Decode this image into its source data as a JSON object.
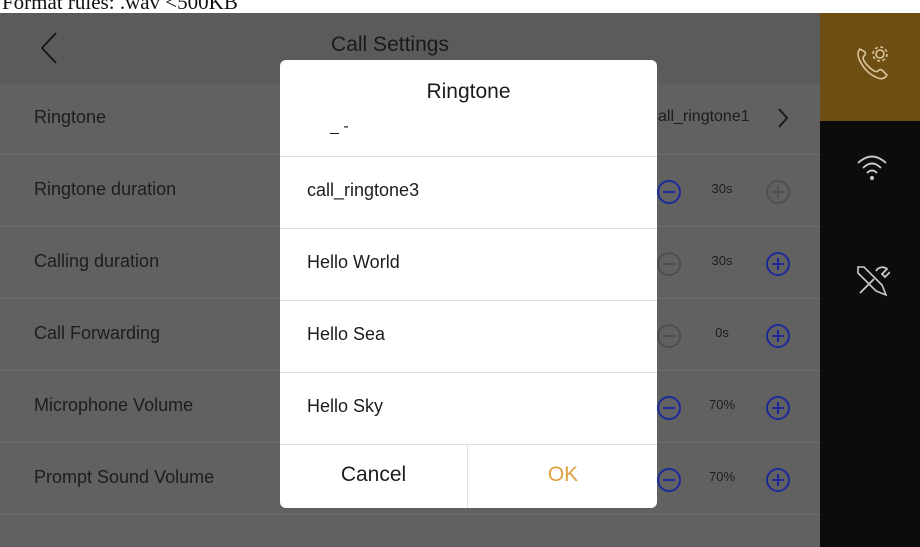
{
  "caption": "Format rules: .wav <500KB",
  "header": {
    "title": "Call Settings"
  },
  "rows": [
    {
      "label": "Ringtone",
      "value": "call_ringtone1"
    },
    {
      "label": "Ringtone duration",
      "value": "30s",
      "minus_enabled": true,
      "plus_enabled": false
    },
    {
      "label": "Calling duration",
      "value": "30s",
      "minus_enabled": false,
      "plus_enabled": true
    },
    {
      "label": "Call Forwarding",
      "value": "0s",
      "minus_enabled": false,
      "plus_enabled": true
    },
    {
      "label": "Microphone Volume",
      "value": "70%",
      "minus_enabled": true,
      "plus_enabled": true
    },
    {
      "label": "Prompt Sound Volume",
      "value": "70%",
      "minus_enabled": true,
      "plus_enabled": true
    }
  ],
  "sidebar": {
    "active_index": 0,
    "items": [
      {
        "icon": "call-settings-icon"
      },
      {
        "icon": "wifi-icon"
      },
      {
        "icon": "tools-icon"
      }
    ]
  },
  "dialog": {
    "title": "Ringtone",
    "partial_option": "_ -",
    "options": [
      "call_ringtone3",
      "Hello World",
      "Hello Sea",
      "Hello Sky"
    ],
    "cancel_label": "Cancel",
    "ok_label": "OK"
  },
  "colors": {
    "accent_blue": "#1e2a9a",
    "ok_orange": "#e0a040",
    "sidebar_active": "#6e4e12"
  }
}
